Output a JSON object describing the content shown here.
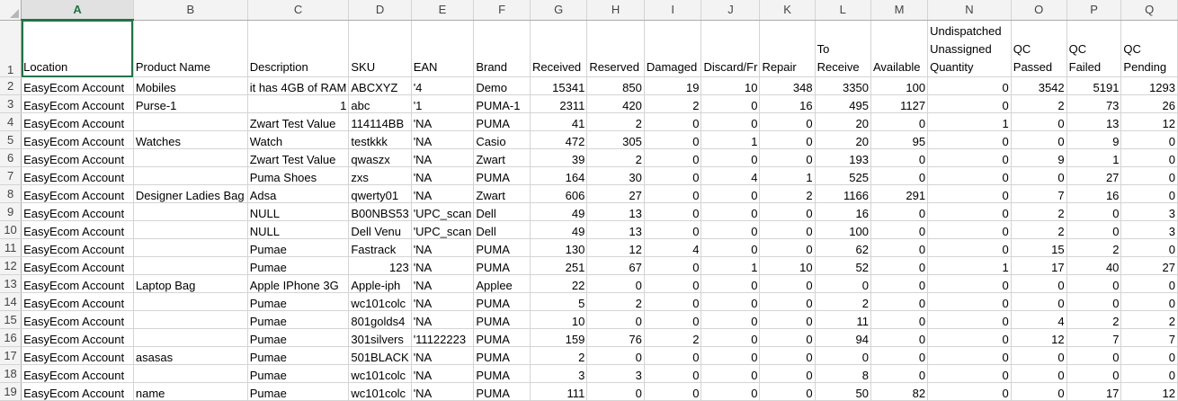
{
  "colors": {
    "accent": "#217346",
    "grid": "#d4d4d4",
    "header_bg": "#f3f3f3"
  },
  "column_letters": [
    "A",
    "B",
    "C",
    "D",
    "E",
    "F",
    "G",
    "H",
    "I",
    "J",
    "K",
    "L",
    "M",
    "N",
    "O",
    "P",
    "Q"
  ],
  "row_numbers": [
    "1",
    "2",
    "3",
    "4",
    "5",
    "6",
    "7",
    "8",
    "9",
    "10",
    "11",
    "12",
    "13",
    "14",
    "15",
    "16",
    "17",
    "18",
    "19"
  ],
  "headers": [
    "Location",
    "Product Name",
    "Description",
    "SKU",
    "EAN",
    "Brand",
    "Received",
    "Reserved",
    "Damaged",
    "Discard/Fr",
    "Repair",
    "To Receive",
    "Available",
    "Undispatched Unassigned Quantity",
    "QC Passed",
    "QC Failed",
    "QC Pending"
  ],
  "rows": [
    [
      "EasyEcom Account",
      "Mobiles",
      "it has 4GB of RAM",
      "ABCXYZ",
      "'4",
      "Demo",
      "15341",
      "850",
      "19",
      "10",
      "348",
      "3350",
      "100",
      "0",
      "3542",
      "5191",
      "1293"
    ],
    [
      "EasyEcom Account",
      "Purse-1",
      "1",
      "abc",
      "'1",
      "PUMA-1",
      "2311",
      "420",
      "2",
      "0",
      "16",
      "495",
      "1127",
      "0",
      "2",
      "73",
      "26"
    ],
    [
      "EasyEcom Account",
      "",
      "Zwart Test Value",
      "114114BB",
      "'NA",
      "PUMA",
      "41",
      "2",
      "0",
      "0",
      "0",
      "20",
      "0",
      "1",
      "0",
      "13",
      "12"
    ],
    [
      "EasyEcom Account",
      "Watches",
      "Watch",
      "testkkk",
      "'NA",
      "Casio",
      "472",
      "305",
      "0",
      "1",
      "0",
      "20",
      "95",
      "0",
      "0",
      "9",
      "0"
    ],
    [
      "EasyEcom Account",
      "",
      "Zwart Test Value",
      "qwaszx",
      "'NA",
      "Zwart",
      "39",
      "2",
      "0",
      "0",
      "0",
      "193",
      "0",
      "0",
      "9",
      "1",
      "0"
    ],
    [
      "EasyEcom Account",
      "",
      "Puma Shoes",
      "zxs",
      "'NA",
      "PUMA",
      "164",
      "30",
      "0",
      "4",
      "1",
      "525",
      "0",
      "0",
      "0",
      "27",
      "0"
    ],
    [
      "EasyEcom Account",
      "Designer Ladies Bag",
      "Adsa",
      "qwerty01",
      "'NA",
      "Zwart",
      "606",
      "27",
      "0",
      "0",
      "2",
      "1166",
      "291",
      "0",
      "7",
      "16",
      "0"
    ],
    [
      "EasyEcom Account",
      "",
      "NULL",
      "B00NBS53",
      "'UPC_scan",
      "Dell",
      "49",
      "13",
      "0",
      "0",
      "0",
      "16",
      "0",
      "0",
      "2",
      "0",
      "3"
    ],
    [
      "EasyEcom Account",
      "",
      "NULL",
      "Dell Venu",
      "'UPC_scan",
      "Dell",
      "49",
      "13",
      "0",
      "0",
      "0",
      "100",
      "0",
      "0",
      "2",
      "0",
      "3"
    ],
    [
      "EasyEcom Account",
      "",
      "Pumae",
      "Fastrack",
      "'NA",
      "PUMA",
      "130",
      "12",
      "4",
      "0",
      "0",
      "62",
      "0",
      "0",
      "15",
      "2",
      "0"
    ],
    [
      "EasyEcom Account",
      "",
      "Pumae",
      "123",
      "'NA",
      "PUMA",
      "251",
      "67",
      "0",
      "1",
      "10",
      "52",
      "0",
      "1",
      "17",
      "40",
      "27"
    ],
    [
      "EasyEcom Account",
      "Laptop Bag",
      "Apple IPhone 3G",
      "Apple-iph",
      "'NA",
      "Applee",
      "22",
      "0",
      "0",
      "0",
      "0",
      "0",
      "0",
      "0",
      "0",
      "0",
      "0"
    ],
    [
      "EasyEcom Account",
      "",
      "Pumae",
      "wc101colc",
      "'NA",
      "PUMA",
      "5",
      "2",
      "0",
      "0",
      "0",
      "2",
      "0",
      "0",
      "0",
      "0",
      "0"
    ],
    [
      "EasyEcom Account",
      "",
      "Pumae",
      "801golds4",
      "'NA",
      "PUMA",
      "10",
      "0",
      "0",
      "0",
      "0",
      "11",
      "0",
      "0",
      "4",
      "2",
      "2"
    ],
    [
      "EasyEcom Account",
      "",
      "Pumae",
      "301silvers",
      "'11122223",
      "PUMA",
      "159",
      "76",
      "2",
      "0",
      "0",
      "94",
      "0",
      "0",
      "12",
      "7",
      "7"
    ],
    [
      "EasyEcom Account",
      "asasas",
      "Pumae",
      "501BLACK",
      "'NA",
      "PUMA",
      "2",
      "0",
      "0",
      "0",
      "0",
      "0",
      "0",
      "0",
      "0",
      "0",
      "0"
    ],
    [
      "EasyEcom Account",
      "",
      "Pumae",
      "wc101colc",
      "'NA",
      "PUMA",
      "3",
      "3",
      "0",
      "0",
      "0",
      "8",
      "0",
      "0",
      "0",
      "0",
      "0"
    ],
    [
      "EasyEcom Account",
      "name",
      "Pumae",
      "wc101colc",
      "'NA",
      "PUMA",
      "111",
      "0",
      "0",
      "0",
      "0",
      "50",
      "82",
      "0",
      "0",
      "17",
      "12"
    ]
  ]
}
